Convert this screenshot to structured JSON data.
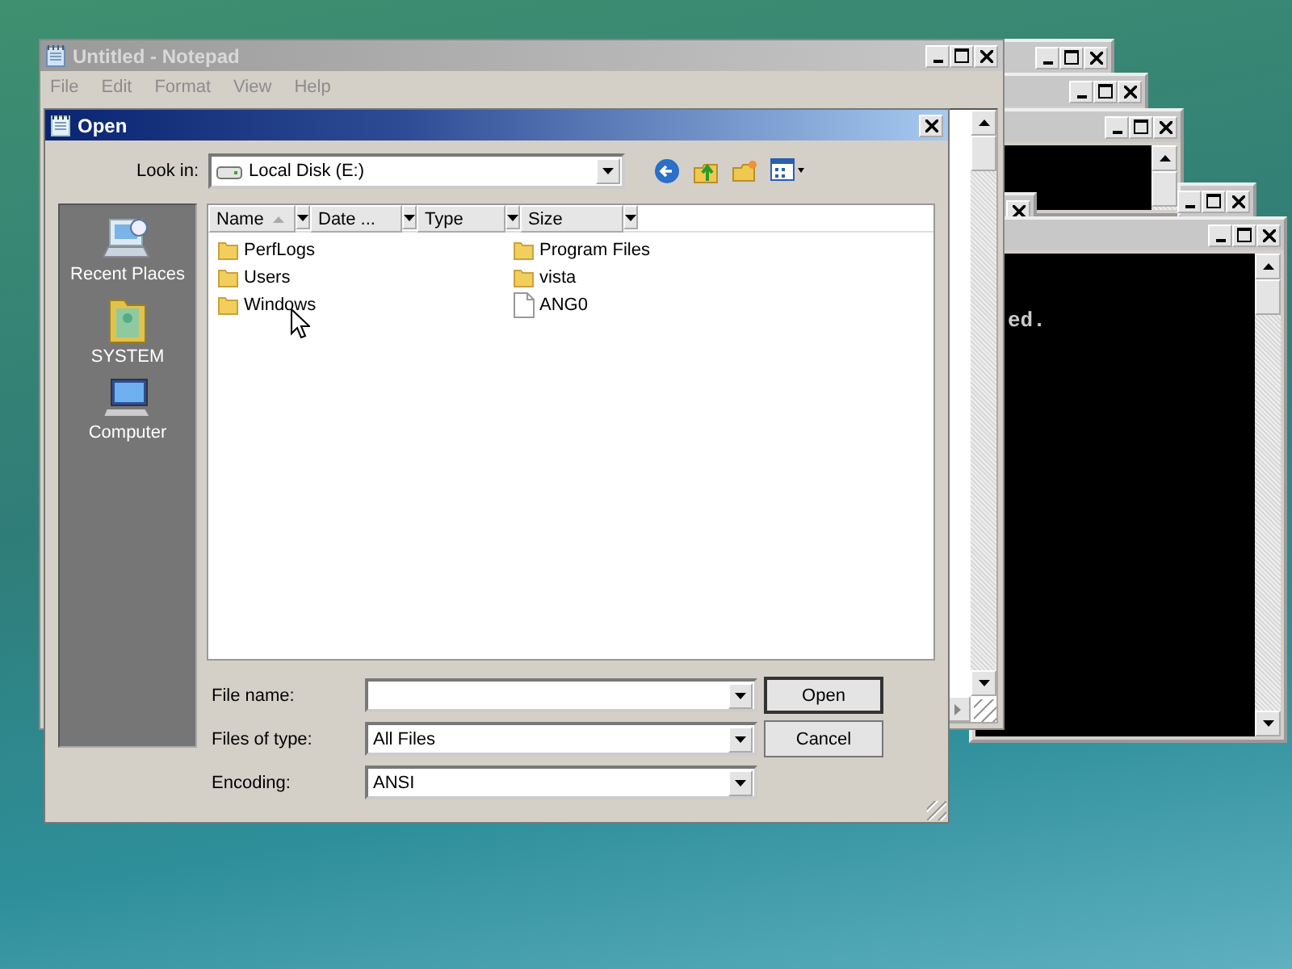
{
  "console": {
    "text": "ed."
  },
  "notepad": {
    "title": "Untitled - Notepad",
    "menu": [
      "File",
      "Edit",
      "Format",
      "View",
      "Help"
    ]
  },
  "dialog": {
    "title": "Open",
    "look_in": {
      "label": "Look in:",
      "value": "Local Disk (E:)"
    },
    "places": [
      {
        "label": "Recent Places",
        "kind": "recent"
      },
      {
        "label": "SYSTEM",
        "kind": "user"
      },
      {
        "label": "Computer",
        "kind": "computer"
      }
    ],
    "columns": [
      "Name",
      "Date ...",
      "Type",
      "Size"
    ],
    "files": [
      {
        "name": "PerfLogs",
        "kind": "folder"
      },
      {
        "name": "Users",
        "kind": "folder"
      },
      {
        "name": "Windows",
        "kind": "folder"
      },
      {
        "name": "Program Files",
        "kind": "folder"
      },
      {
        "name": "vista",
        "kind": "folder"
      },
      {
        "name": "ANG0",
        "kind": "file"
      }
    ],
    "fields": [
      {
        "label": "File name:"
      },
      {
        "label": "Files of type:",
        "value": "All Files"
      },
      {
        "label": "Encoding:",
        "value": "ANSI"
      }
    ],
    "buttons": [
      "Open",
      "Cancel"
    ]
  }
}
